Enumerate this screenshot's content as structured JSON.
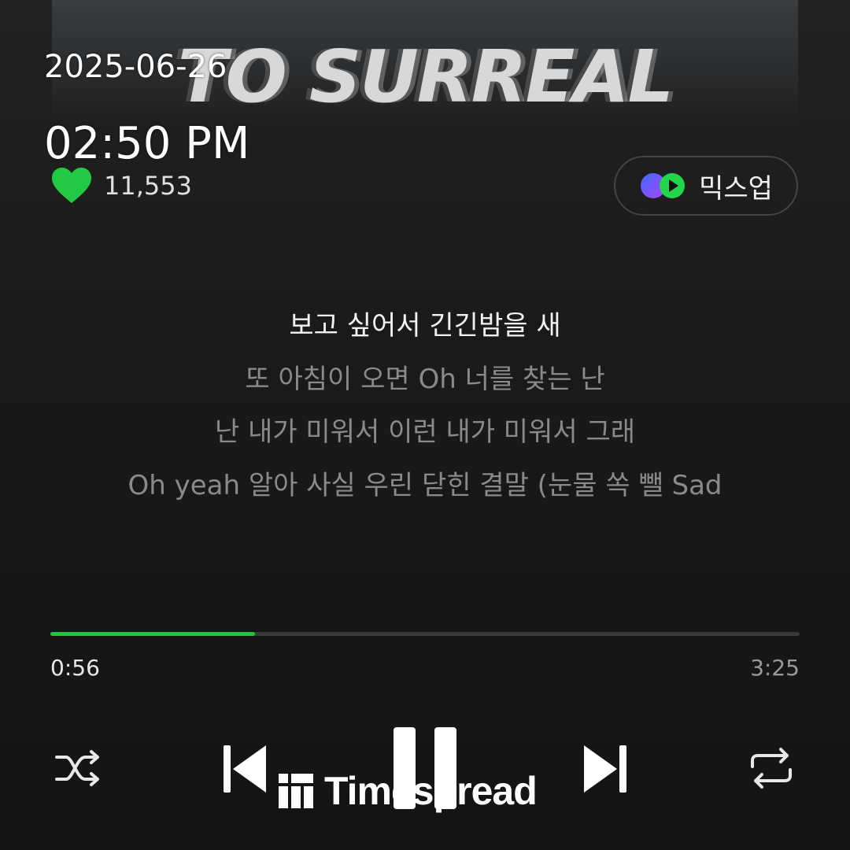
{
  "album": {
    "title": "TO SURREAL"
  },
  "overlay": {
    "date": "2025-06-26",
    "time": "02:50 PM"
  },
  "like": {
    "count": "11,553",
    "icon": "heart-icon",
    "color": "#22c943"
  },
  "mixup": {
    "label": "믹스업",
    "icon": "mixup-icon"
  },
  "lyrics": [
    {
      "text": "보고 싶어서 긴긴밤을 새",
      "current": true
    },
    {
      "text": "또 아침이 오면 Oh 너를 찾는 난",
      "current": false
    },
    {
      "text": "난 내가 미워서 이런 내가 미워서 그래",
      "current": false
    },
    {
      "text": "Oh yeah 알아 사실 우린 닫힌 결말 (눈물 쏙 뺄 Sad",
      "current": false
    }
  ],
  "player": {
    "elapsed": "0:56",
    "total": "3:25",
    "progress": 0.2732,
    "accent": "#1ec83a"
  },
  "controls": {
    "shuffle": "shuffle-icon",
    "previous": "skip-previous-icon",
    "pause": "pause-icon",
    "next": "skip-next-icon",
    "repeat": "repeat-icon"
  },
  "watermark": {
    "text": "Timespread"
  }
}
